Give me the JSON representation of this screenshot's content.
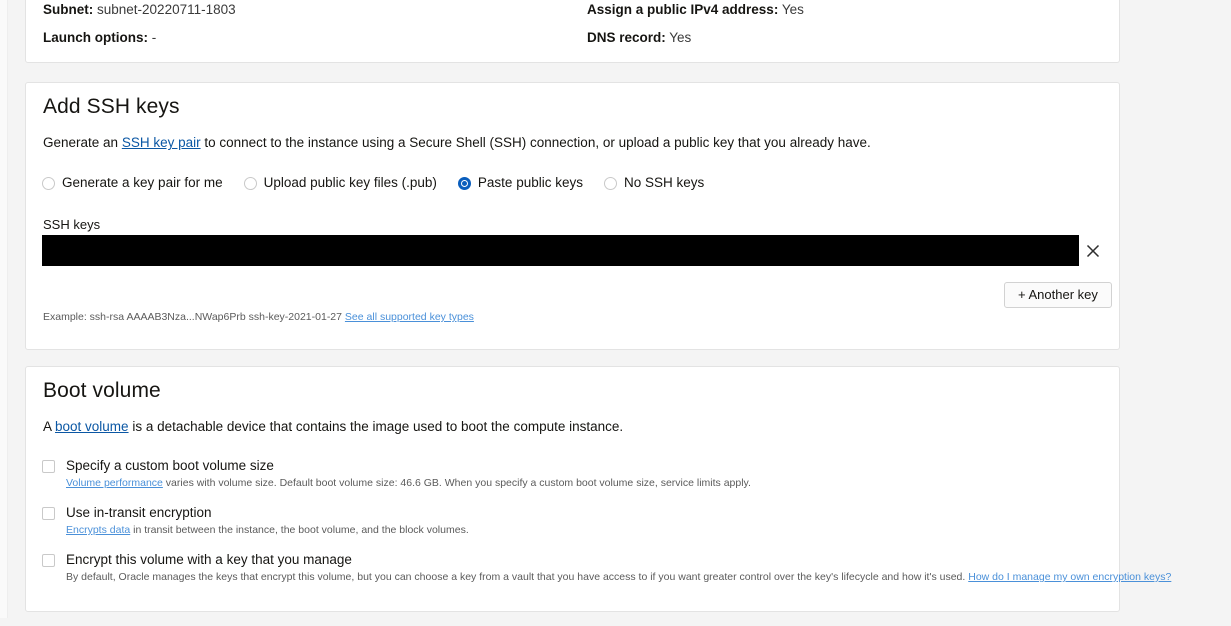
{
  "summary": {
    "items": [
      {
        "label": "Subnet:",
        "value": "subnet-20220711-1803"
      },
      {
        "label": "Launch options:",
        "value": "-"
      },
      {
        "label": "Assign a public IPv4 address:",
        "value": "Yes"
      },
      {
        "label": "DNS record:",
        "value": "Yes"
      }
    ]
  },
  "ssh": {
    "title": "Add SSH keys",
    "desc_before": "Generate an ",
    "desc_link": "SSH key pair",
    "desc_after": " to connect to the instance using a Secure Shell (SSH) connection, or upload a public key that you already have.",
    "options": [
      {
        "label": "Generate a key pair for me",
        "selected": false
      },
      {
        "label": "Upload public key files (.pub)",
        "selected": false
      },
      {
        "label": "Paste public keys",
        "selected": true
      },
      {
        "label": "No SSH keys",
        "selected": false
      }
    ],
    "field_label": "SSH keys",
    "field_value": "",
    "field_redacted": true,
    "clear_icon": "close-x-icon",
    "another_key_label": "+ Another key",
    "example_text": "Example: ssh-rsa AAAAB3Nza...NWap6Prb ssh-key-2021-01-27",
    "example_link": "See all supported key types"
  },
  "boot": {
    "title": "Boot volume",
    "desc_before": "A ",
    "desc_link": "boot volume",
    "desc_after": " is a detachable device that contains the image used to boot the compute instance.",
    "checkboxes": [
      {
        "label": "Specify a custom boot volume size",
        "checked": false,
        "sub_link": "Volume performance",
        "sub_text": " varies with volume size. Default boot volume size: 46.6 GB. When you specify a custom boot volume size, service limits apply.",
        "sub_link_trailing": ""
      },
      {
        "label": "Use in-transit encryption",
        "checked": false,
        "sub_link": "Encrypts data",
        "sub_text": " in transit between the instance, the boot volume, and the block volumes.",
        "sub_link_trailing": ""
      },
      {
        "label": "Encrypt this volume with a key that you manage",
        "checked": false,
        "sub_link": "",
        "sub_text": "By default, Oracle manages the keys that encrypt this volume, but you can choose a key from a vault that you have access to if you want greater control over the key's lifecycle and how it's used. ",
        "sub_link_trailing": "How do I manage my own encryption keys?"
      }
    ]
  },
  "colors": {
    "accent_blue": "#0a5ebd",
    "link_blue": "#0b57a4",
    "small_link_blue": "#4a90d9",
    "page_bg": "#f4f4f4",
    "card_bg": "#ffffff",
    "redaction": "#000000"
  }
}
